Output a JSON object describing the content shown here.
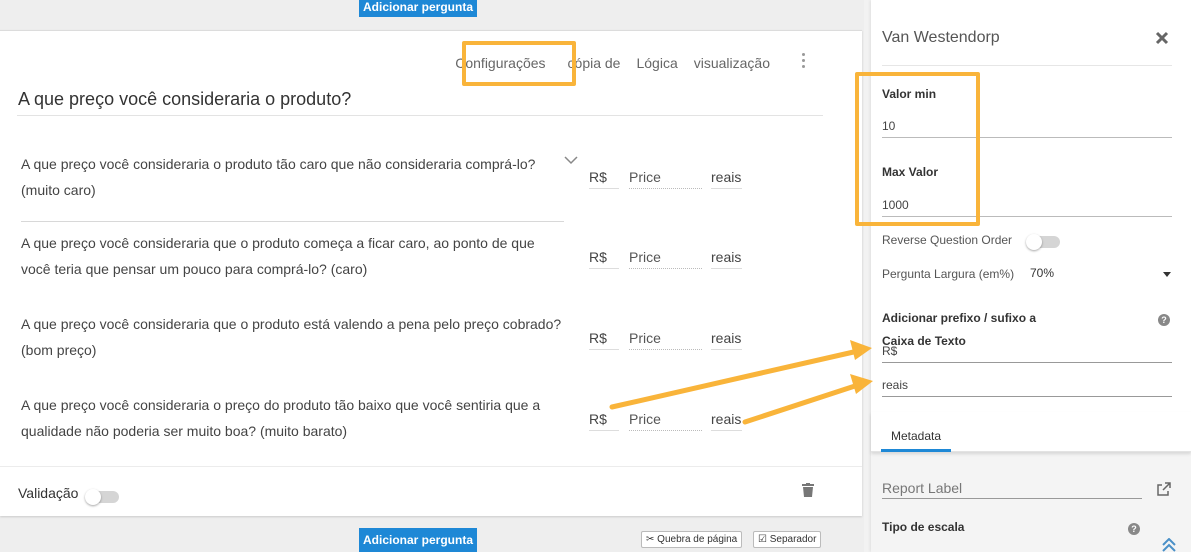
{
  "builder": {
    "add_question_top": "Adicionar pergunta",
    "add_question_bottom": "Adicionar pergunta",
    "page_break_label": "Quebra de página",
    "separator_label": "Separador",
    "tabs": [
      "Configurações",
      "cópia de",
      "Lógica",
      "visualização"
    ],
    "question_title": "A que preço você consideraria o produto?",
    "rows": [
      {
        "text": "A que preço você consideraria o produto tão caro que não consideraria comprá-lo? (muito caro)",
        "prefix": "R$",
        "placeholder": "Price",
        "suffix": "reais"
      },
      {
        "text": "A que preço você consideraria que o produto começa a ficar caro, ao ponto de que você teria que pensar um pouco para comprá-lo? (caro)",
        "prefix": "R$",
        "placeholder": "Price",
        "suffix": "reais"
      },
      {
        "text": "A que preço você consideraria que o produto está valendo a pena pelo preço cobrado? (bom preço)",
        "prefix": "R$",
        "placeholder": "Price",
        "suffix": "reais"
      },
      {
        "text": "A que preço você consideraria o preço do produto tão baixo que você sentiria que a qualidade não poderia ser muito boa? (muito barato)",
        "prefix": "R$",
        "placeholder": "Price",
        "suffix": "reais"
      }
    ],
    "validation_label": "Validação"
  },
  "panel": {
    "title": "Van Westendorp",
    "min_label": "Valor min",
    "min_value": "10",
    "max_label": "Max Valor",
    "max_value": "1000",
    "reverse_label": "Reverse Question Order",
    "width_label": "Pergunta Largura (em%)",
    "width_value": "70%",
    "prefix_suffix_label_1": "Adicionar prefixo / sufixo a",
    "prefix_suffix_label_2": "Caixa de Texto",
    "prefix_value": "R$",
    "suffix_value": "reais",
    "metadata_tab": "Metadata",
    "report_label_placeholder": "Report Label",
    "scale_type_label": "Tipo de escala"
  },
  "colors": {
    "accent": "#1e88d6",
    "highlight": "#f9b43a"
  }
}
